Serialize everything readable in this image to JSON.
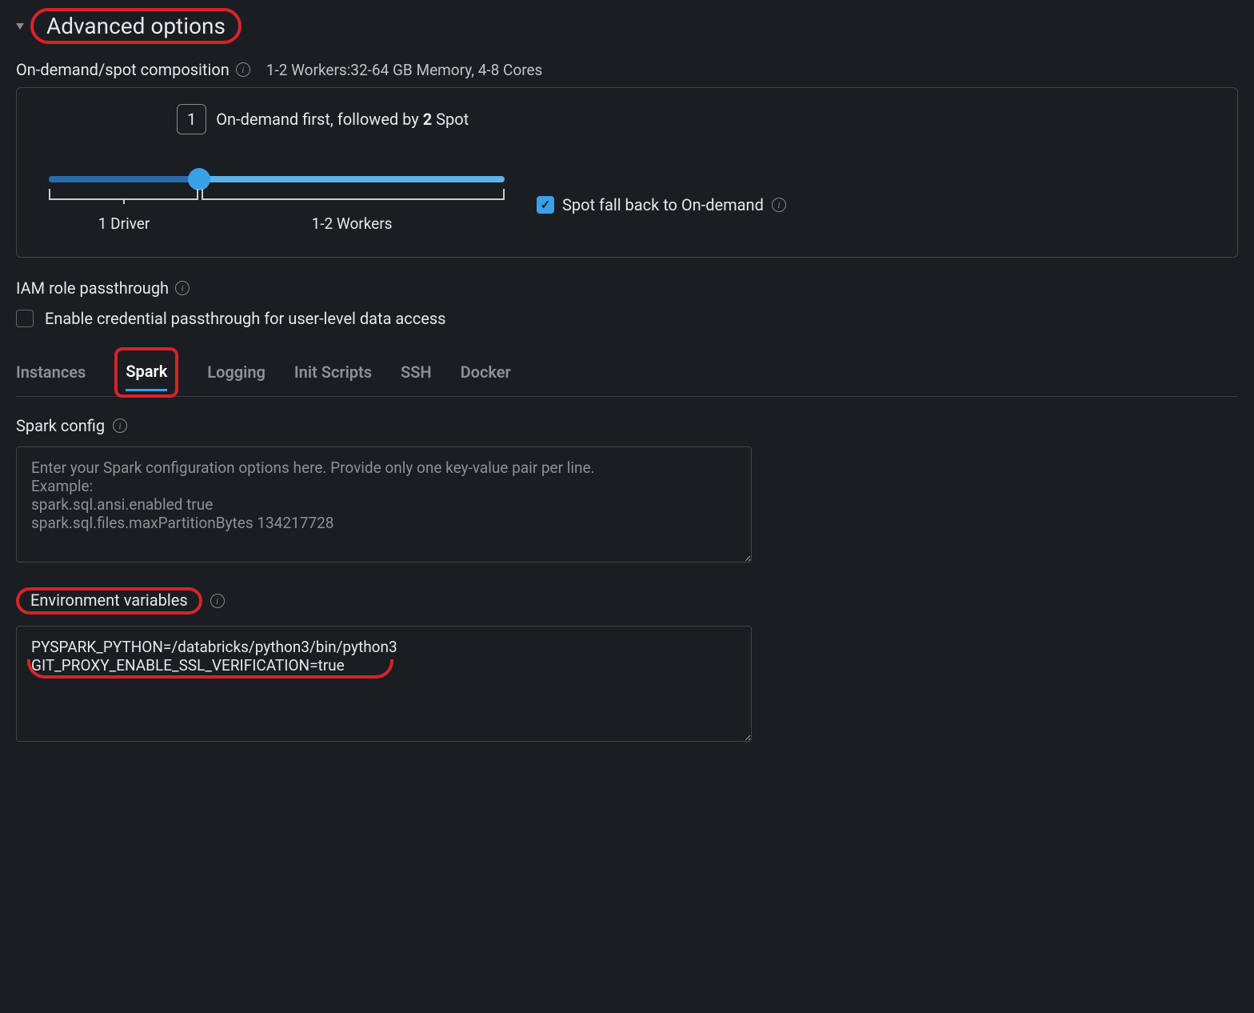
{
  "header": {
    "title": "Advanced options"
  },
  "composition": {
    "label": "On-demand/spot composition",
    "summary": "1-2 Workers:32-64 GB Memory, 4-8 Cores",
    "slider_value": "1",
    "slider_desc_prefix": "On-demand first, followed by ",
    "slider_desc_count": "2",
    "slider_desc_suffix": " Spot",
    "driver_label": "1 Driver",
    "workers_label": "1-2 Workers",
    "fallback_label": "Spot fall back to On-demand"
  },
  "iam": {
    "label": "IAM role passthrough",
    "checkbox_label": "Enable credential passthrough for user-level data access"
  },
  "tabs": {
    "instances": "Instances",
    "spark": "Spark",
    "logging": "Logging",
    "init_scripts": "Init Scripts",
    "ssh": "SSH",
    "docker": "Docker"
  },
  "spark_config": {
    "label": "Spark config",
    "placeholder": "Enter your Spark configuration options here. Provide only one key-value pair per line.\nExample:\nspark.sql.ansi.enabled true\nspark.sql.files.maxPartitionBytes 134217728"
  },
  "env_vars": {
    "label": "Environment variables",
    "value": "PYSPARK_PYTHON=/databricks/python3/bin/python3\nGIT_PROXY_ENABLE_SSL_VERIFICATION=true"
  }
}
